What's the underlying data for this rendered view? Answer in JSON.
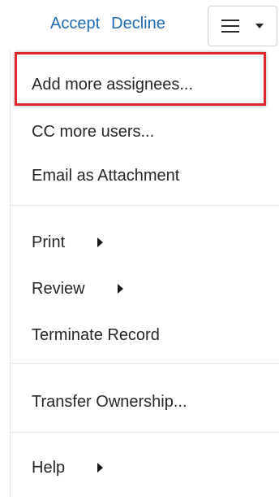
{
  "header": {
    "accept_label": "Accept",
    "decline_label": "Decline"
  },
  "menu": {
    "items": [
      {
        "label": "Add more assignees..."
      },
      {
        "label": "CC more users..."
      },
      {
        "label": "Email as Attachment"
      },
      {
        "label": "Print"
      },
      {
        "label": "Review"
      },
      {
        "label": "Terminate Record"
      },
      {
        "label": "Transfer Ownership..."
      },
      {
        "label": "Help"
      }
    ]
  },
  "colors": {
    "link": "#1f6bb5",
    "highlight_border": "#e0262f",
    "text": "#262626"
  },
  "icons": [
    "hamburger-menu-icon",
    "chevron-down-icon",
    "submenu-arrow-icon"
  ]
}
